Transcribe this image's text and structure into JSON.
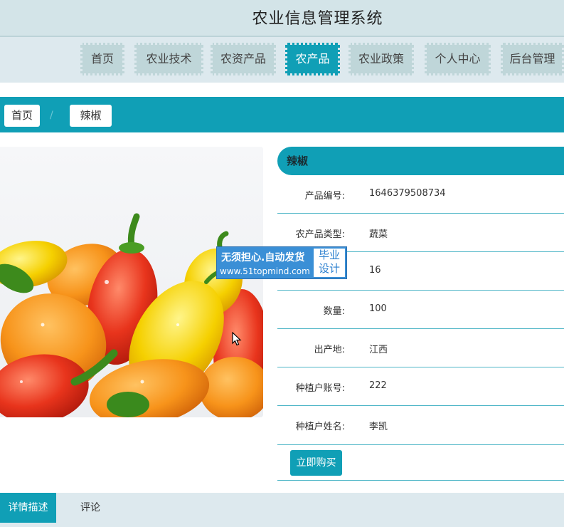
{
  "header": {
    "title": "农业信息管理系统"
  },
  "nav": {
    "items": [
      {
        "label": "首页"
      },
      {
        "label": "农业技术"
      },
      {
        "label": "农资产品"
      },
      {
        "label": "农产品"
      },
      {
        "label": "农业政策"
      },
      {
        "label": "个人中心"
      },
      {
        "label": "后台管理"
      }
    ],
    "active_label": "农产品"
  },
  "breadcrumb": {
    "home": "首页",
    "separator": "/",
    "current": "辣椒"
  },
  "product": {
    "name": "辣椒",
    "image_icon": "pepper-image",
    "fields": [
      {
        "label": "产品编号:",
        "value": "1646379508734"
      },
      {
        "label": "农产品类型:",
        "value": "蔬菜"
      },
      {
        "label": "",
        "value": "16"
      },
      {
        "label": "数量:",
        "value": "100"
      },
      {
        "label": "出产地:",
        "value": "江西"
      },
      {
        "label": "种植户账号:",
        "value": "222"
      },
      {
        "label": "种植户姓名:",
        "value": "李凯"
      }
    ],
    "buy_label": "立即购买"
  },
  "watermark": {
    "line1": "无须担心.自动发货",
    "line2": "www.51topmind.com",
    "badge_top": "毕业",
    "badge_bottom": "设计"
  },
  "tabs": [
    {
      "label": "详情描述",
      "active": true
    },
    {
      "label": "评论",
      "active": false
    }
  ],
  "colors": {
    "accent": "#109fb6",
    "header_bg": "#d3e4e8",
    "nav_bg": "#bfd6d9"
  }
}
